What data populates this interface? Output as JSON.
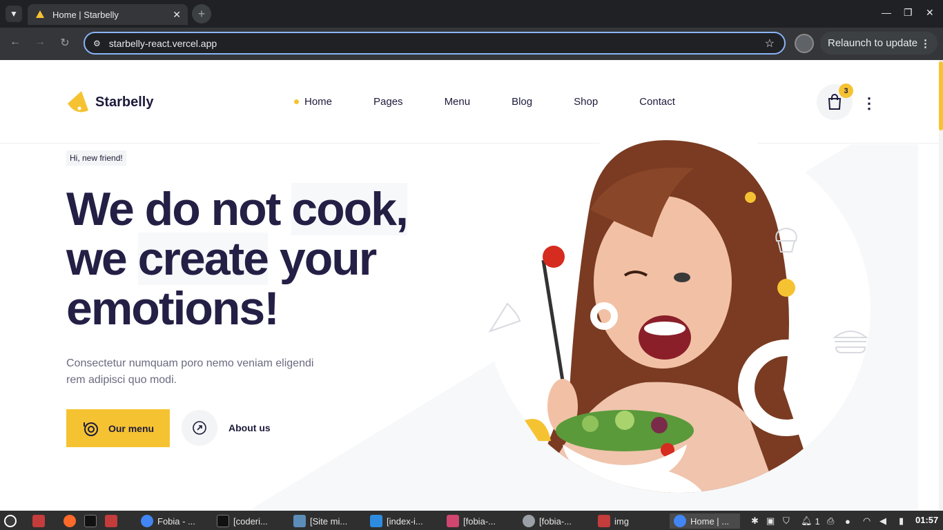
{
  "browser": {
    "tab_title": "Home | Starbelly",
    "url": "starbelly-react.vercel.app",
    "relaunch_label": "Relaunch to update"
  },
  "site": {
    "logo_name": "Starbelly",
    "menu": [
      "Home",
      "Pages",
      "Menu",
      "Blog",
      "Shop",
      "Contact"
    ],
    "cart_count": "3"
  },
  "hero": {
    "eyebrow": "Hi, new friend!",
    "headline_1a": "We do not ",
    "headline_1b": "cook,",
    "headline_2a": "we ",
    "headline_2b": "create",
    "headline_2c": " your",
    "headline_3": "emotions!",
    "subtext": "Consectetur numquam poro nemo veniam eligendi rem adipisci quo modi.",
    "btn_menu": "Our menu",
    "btn_about": "About us"
  },
  "taskbar": {
    "items": [
      "Fobia - ...",
      "[coderi...",
      "[Site mi...",
      "[index-i...",
      "[fobia-...",
      "[fobia-...",
      "img",
      "Home | ..."
    ],
    "clock": "01:57",
    "notif_count": "1"
  },
  "colors": {
    "accent": "#f5c332",
    "ink": "#231f45"
  }
}
